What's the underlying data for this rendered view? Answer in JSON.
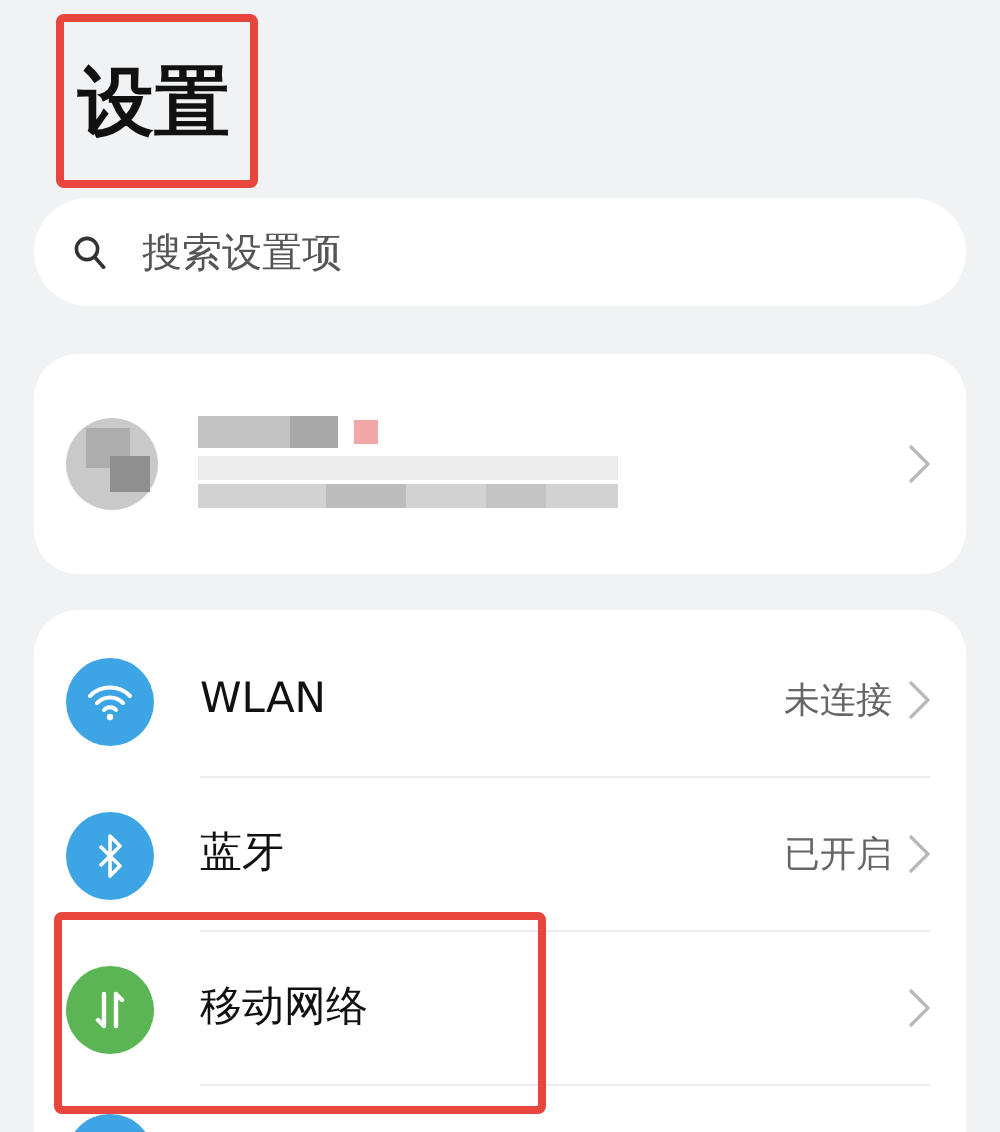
{
  "title": {
    "text": "设置",
    "highlighted": true
  },
  "search": {
    "placeholder": "搜索设置项"
  },
  "settings": [
    {
      "kind": "wifi",
      "label": "WLAN",
      "value": "未连接",
      "color": "#3ea5e5",
      "highlighted": false
    },
    {
      "kind": "bluetooth",
      "label": "蓝牙",
      "value": "已开启",
      "color": "#3ea5e5",
      "highlighted": false
    },
    {
      "kind": "mobile-data",
      "label": "移动网络",
      "color": "#5cb554",
      "highlighted": true
    },
    {
      "kind": "cut-off",
      "color": "#3ea5e5"
    }
  ]
}
